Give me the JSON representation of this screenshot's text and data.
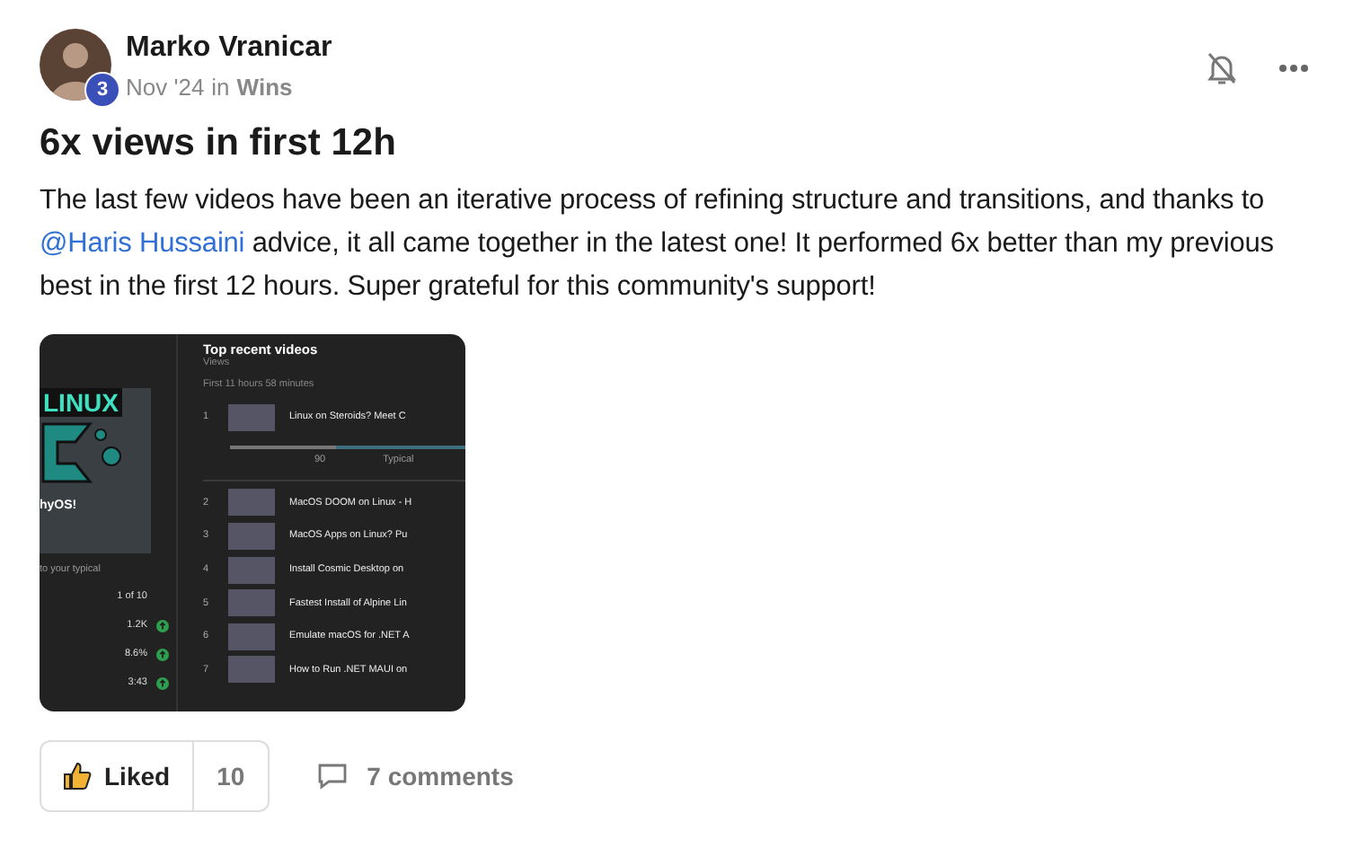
{
  "author": {
    "name": "Marko Vranicar",
    "level": "3"
  },
  "meta": {
    "date": "Nov '24",
    "in": "in",
    "category": "Wins"
  },
  "post": {
    "title": "6x views in first 12h",
    "body": [
      {
        "kind": "text",
        "text": "The last few videos have been an iterative process of refining structure and transitions, and thanks to "
      },
      {
        "kind": "mention",
        "text": "@Haris Hussaini"
      },
      {
        "kind": "text",
        "text": " advice, it all came together in the latest one! It performed 6x better than my previous best in the first 12 hours. Super grateful for this community's support!"
      }
    ]
  },
  "screenshot": {
    "thumb_title": "LINUX",
    "thumb_caption": "hyOS!",
    "compare": "to your typical",
    "stats": [
      {
        "value": "1 of 10",
        "up": false
      },
      {
        "value": "1.2K",
        "up": true
      },
      {
        "value": "8.6%",
        "up": true
      },
      {
        "value": "3:43",
        "up": true
      }
    ],
    "heading": "Top recent videos",
    "metric": "Views",
    "period": "First 11 hours 58 minutes",
    "first": {
      "rank": "1",
      "title": "Linux on Steroids? Meet C"
    },
    "bar": {
      "level": 0.45,
      "value": "90",
      "label": "Typical"
    },
    "videos": [
      {
        "rank": "2",
        "title": "MacOS DOOM on Linux - H"
      },
      {
        "rank": "3",
        "title": "MacOS Apps on Linux? Pu"
      },
      {
        "rank": "4",
        "title": "Install Cosmic Desktop on"
      },
      {
        "rank": "5",
        "title": "Fastest Install of Alpine Lin"
      },
      {
        "rank": "6",
        "title": "Emulate macOS for .NET A"
      },
      {
        "rank": "7",
        "title": "How to Run .NET MAUI on"
      }
    ]
  },
  "actions": {
    "like": {
      "label": "Liked",
      "count": "10",
      "selected": true
    },
    "comments": "7 comments"
  }
}
